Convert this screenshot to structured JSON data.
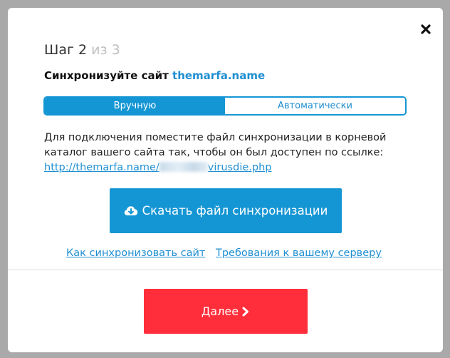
{
  "dialog": {
    "close_icon": "close-icon",
    "step": {
      "label": "Шаг 2",
      "of": "из 3"
    },
    "subtitle": {
      "text": "Синхронизуйте сайт",
      "site": "themarfa.name"
    },
    "tabs": [
      {
        "label": "Вручную",
        "active": true
      },
      {
        "label": "Автоматически",
        "active": false
      }
    ],
    "instructions": "Для подключения поместите файл синхронизации в корневой каталог вашего сайта так, чтобы он был доступен по ссылке:",
    "sync_link": {
      "prefix": "http://themarfa.name/",
      "suffix": "virusdie.php"
    },
    "download_button": {
      "label": "Скачать файл синхронизации",
      "icon": "cloud-download-icon"
    },
    "help_links": [
      "Как синхронизовать сайт",
      "Требования к вашему серверу"
    ],
    "next_button": {
      "label": "Далее",
      "icon": "chevron-right-icon"
    },
    "colors": {
      "accent": "#1596d4",
      "danger": "#ff2e3a",
      "overlay": "#a9a9a9"
    }
  }
}
